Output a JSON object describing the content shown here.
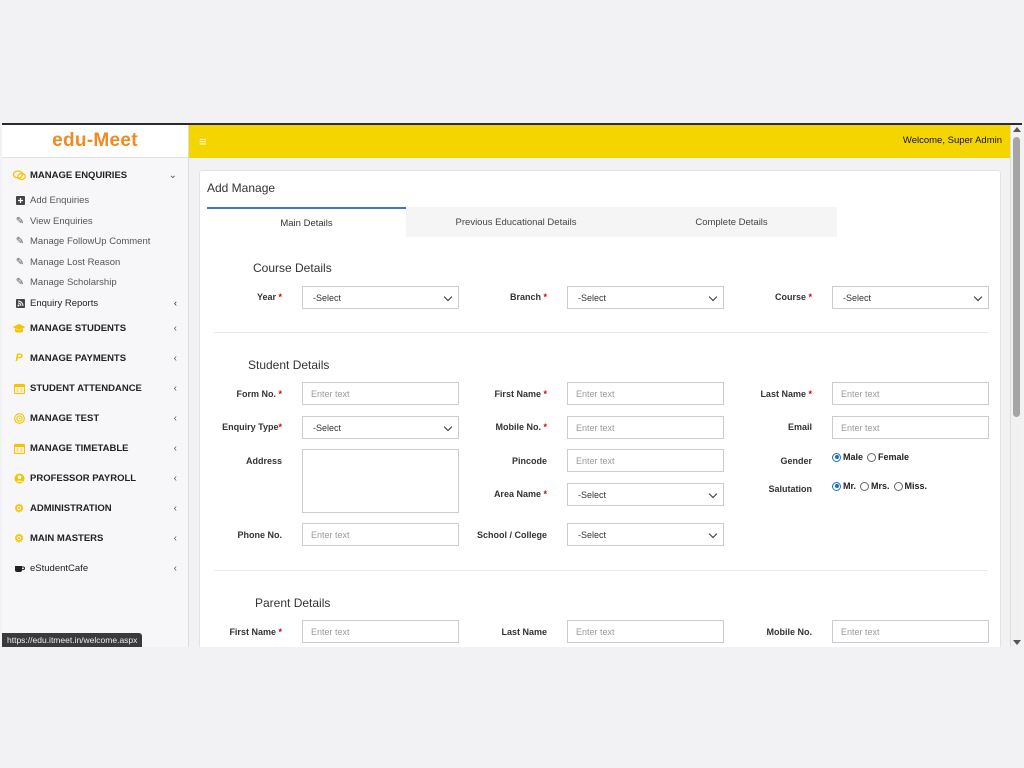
{
  "brand": "edu-Meet",
  "header": {
    "welcome": "Welcome, Super Admin"
  },
  "sidebar": {
    "enquiries": {
      "label": "MANAGE ENQUIRIES",
      "items": [
        {
          "label": "Add Enquiries"
        },
        {
          "label": "View Enquiries"
        },
        {
          "label": "Manage FollowUp Comment"
        },
        {
          "label": "Manage Lost Reason"
        },
        {
          "label": "Manage Scholarship"
        },
        {
          "label": "Enquiry Reports"
        }
      ]
    },
    "sections": [
      {
        "label": "MANAGE STUDENTS"
      },
      {
        "label": "MANAGE PAYMENTS"
      },
      {
        "label": "STUDENT ATTENDANCE"
      },
      {
        "label": "MANAGE TEST"
      },
      {
        "label": "MANAGE TIMETABLE"
      },
      {
        "label": "PROFESSOR PAYROLL"
      },
      {
        "label": "ADMINISTRATION"
      },
      {
        "label": "MAIN MASTERS"
      },
      {
        "label": "eStudentCafe"
      }
    ]
  },
  "status_url": "https://edu.itmeet.in/welcome.aspx",
  "page": {
    "title": "Add Manage",
    "tabs": [
      "Main Details",
      "Previous Educational Details",
      "Complete Details"
    ]
  },
  "course": {
    "title": "Course Details",
    "year_label": "Year",
    "year_value": "-Select",
    "branch_label": "Branch",
    "branch_value": "-Select",
    "course_label": "Course",
    "course_value": "-Select"
  },
  "student": {
    "title": "Student Details",
    "form_no_label": "Form No.",
    "first_name_label": "First Name",
    "last_name_label": "Last Name",
    "enquiry_type_label": "Enquiry Type",
    "enquiry_type_value": "-Select",
    "mobile_label": "Mobile No.",
    "email_label": "Email",
    "address_label": "Address",
    "pincode_label": "Pincode",
    "gender_label": "Gender",
    "gender_male": "Male",
    "gender_female": "Female",
    "area_label": "Area Name",
    "area_value": "-Select",
    "salutation_label": "Salutation",
    "sal_mr": "Mr.",
    "sal_mrs": "Mrs.",
    "sal_miss": "Miss.",
    "phone_label": "Phone No.",
    "school_label": "School / College",
    "school_value": "-Select"
  },
  "parent": {
    "title": "Parent Details",
    "first_name_label": "First Name",
    "last_name_label": "Last Name",
    "mobile_label": "Mobile No."
  },
  "placeholder": "Enter text",
  "required_mark": "*"
}
